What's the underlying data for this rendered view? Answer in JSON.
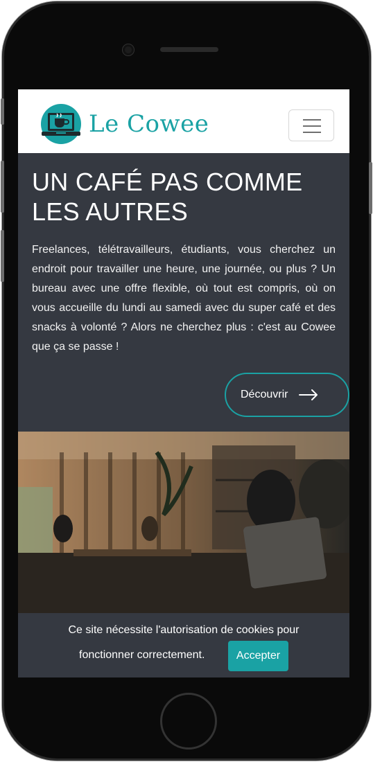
{
  "header": {
    "brand_name": "Le Cowee",
    "logo_icon": "laptop-coffee-icon",
    "menu_icon": "hamburger-menu-icon"
  },
  "hero": {
    "title_line1": "UN CAFÉ PAS COMME",
    "title_line2": "LES AUTRES",
    "text": "Freelances, télétravailleurs, étudiants, vous cherchez un endroit pour travailler une heure, une journée, ou plus ? Un bureau avec une offre flexible, où tout est compris, où on vous accueille du lundi au samedi avec du super café et des snacks à volonté ? Alors ne cherchez plus : c'est au Cowee que ça se passe !",
    "cta_label": "Découvrir",
    "cta_icon": "arrow-right-icon"
  },
  "cookie_banner": {
    "line1": "Ce site nécessite l'autorisation de cookies pour",
    "line2": "fonctionner correctement.",
    "accept_label": "Accepter"
  },
  "colors": {
    "accent": "#1aa2a4",
    "background_dark": "#353941",
    "navbar": "#ffffff"
  }
}
